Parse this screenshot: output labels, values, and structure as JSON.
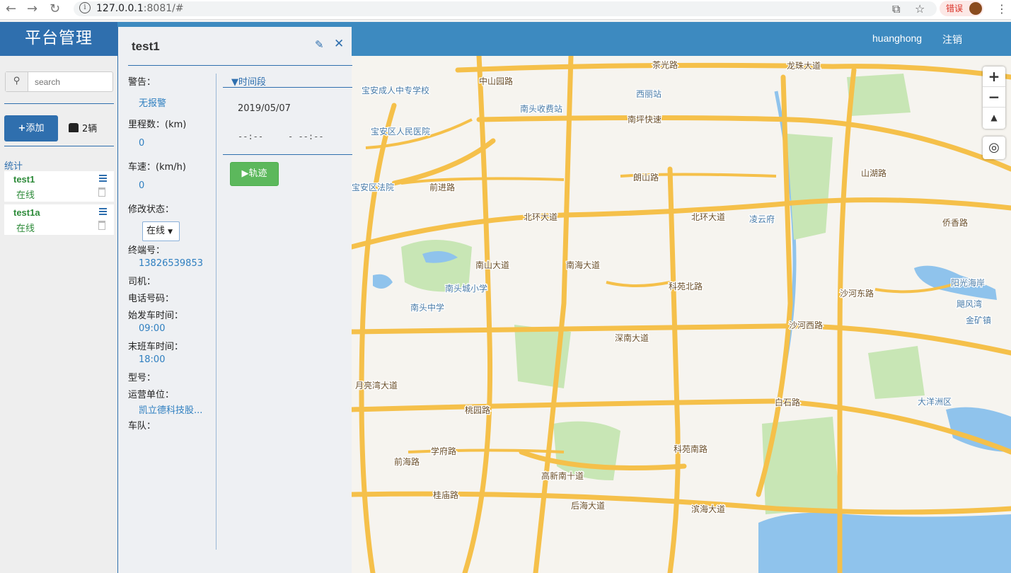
{
  "browser": {
    "url_host": "127.0.0.1",
    "url_rest": ":8081/#",
    "error_label": "错误"
  },
  "header": {
    "brand": "平台管理",
    "username": "huanghong",
    "logout": "注销"
  },
  "sidebar": {
    "search_placeholder": "search",
    "add_label": "添加",
    "vehicle_count": "2辆",
    "stats_label": "统计",
    "vehicles": [
      {
        "name": "test1",
        "status": "在线"
      },
      {
        "name": "test1a",
        "status": "在线"
      }
    ]
  },
  "panel": {
    "title": "test1",
    "fields": {
      "alarm_label": "警告：",
      "alarm_value": "无报警",
      "mileage_label": "里程数：(km)",
      "mileage_value": "0",
      "speed_label": "车速：(km/h)",
      "speed_value": "0",
      "modify_status_label": "修改状态：",
      "status_select": "在线",
      "terminal_label": "终端号：",
      "terminal_value": "13826539853",
      "driver_label": "司机：",
      "phone_label": "电话号码：",
      "first_time_label": "始发车时间：",
      "first_time_value": "09:00",
      "last_time_label": "末班车时间：",
      "last_time_value": "18:00",
      "model_label": "型号：",
      "company_label": "运营单位：",
      "company_value": "凯立德科技股...",
      "fleet_label": "车队："
    },
    "period": {
      "label": "时间段",
      "date": "2019/05/07",
      "start_time": "--:--",
      "end_time": "- --:--"
    },
    "track_button": "轨迹"
  },
  "map": {
    "zoom_in": "+",
    "zoom_out": "−",
    "compass": "▲",
    "labels": [
      {
        "text": "茶光路"
      },
      {
        "text": "龙珠大道"
      },
      {
        "text": "中山园路"
      },
      {
        "text": "宝安成人中专学校"
      },
      {
        "text": "西丽站"
      },
      {
        "text": "南头收费站"
      },
      {
        "text": "南坪快速"
      },
      {
        "text": "宝安区人民医院"
      },
      {
        "text": "前进路"
      },
      {
        "text": "朗山路"
      },
      {
        "text": "山湖路"
      },
      {
        "text": "北环大道"
      },
      {
        "text": "凌云府"
      },
      {
        "text": "侨香路"
      },
      {
        "text": "南山大道"
      },
      {
        "text": "南海大道"
      },
      {
        "text": "南头城小学"
      },
      {
        "text": "南头中学"
      },
      {
        "text": "科苑北路"
      },
      {
        "text": "沙河西路"
      },
      {
        "text": "沙河东路"
      },
      {
        "text": "阳光海岸"
      },
      {
        "text": "飓风湾"
      },
      {
        "text": "金矿镇"
      },
      {
        "text": "深南大道"
      },
      {
        "text": "大洋洲区"
      },
      {
        "text": "白石路"
      },
      {
        "text": "桃园路"
      },
      {
        "text": "学府路"
      },
      {
        "text": "前海路"
      },
      {
        "text": "高新南十道"
      },
      {
        "text": "科苑南路"
      },
      {
        "text": "滨海大道"
      },
      {
        "text": "后海大道"
      },
      {
        "text": "桂庙路"
      },
      {
        "text": "月亮湾大道"
      },
      {
        "text": "北环大道"
      },
      {
        "text": "宝安区法院"
      }
    ]
  },
  "colors": {
    "header": "#3d8ac0",
    "brand_bg": "#2f6fae",
    "online_green": "#2e8b3a",
    "track_green": "#5cb85c",
    "road": "#f5c04a",
    "park": "#c8e6b5",
    "water": "#8fc3ec"
  }
}
